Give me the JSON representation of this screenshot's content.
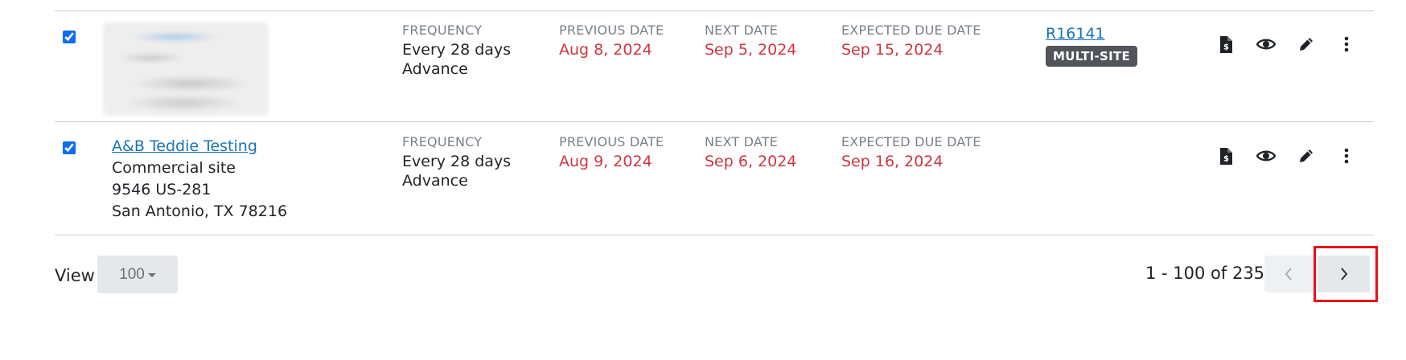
{
  "rows": [
    {
      "selected": true,
      "site": null,
      "frequency_label": "FREQUENCY",
      "frequency_value": "Every 28 days",
      "frequency_mode": "Advance",
      "previous_label": "PREVIOUS DATE",
      "previous_value": "Aug 8, 2024",
      "next_label": "NEXT DATE",
      "next_value": "Sep 5, 2024",
      "due_label": "EXPECTED DUE DATE",
      "due_value": "Sep 15, 2024",
      "reference": "R16141",
      "badge": "MULTI-SITE"
    },
    {
      "selected": true,
      "site": {
        "name": "A&B Teddie Testing",
        "type": "Commercial site",
        "address1": "9546 US-281",
        "address2": "San Antonio, TX 78216"
      },
      "frequency_label": "FREQUENCY",
      "frequency_value": "Every 28 days",
      "frequency_mode": "Advance",
      "previous_label": "PREVIOUS DATE",
      "previous_value": "Aug 9, 2024",
      "next_label": "NEXT DATE",
      "next_value": "Sep 6, 2024",
      "due_label": "EXPECTED DUE DATE",
      "due_value": "Sep 16, 2024"
    }
  ],
  "icons": [
    "invoice-icon",
    "eye-icon",
    "pencil-icon",
    "more-vertical-icon"
  ],
  "colors": {
    "link": "#1a73b8",
    "date_red": "#d0363f",
    "badge_bg": "#50555b",
    "highlight": "#e8101a"
  },
  "footer": {
    "view_label": "View",
    "page_size": "100",
    "range_text": "1 - 100 of 235"
  }
}
